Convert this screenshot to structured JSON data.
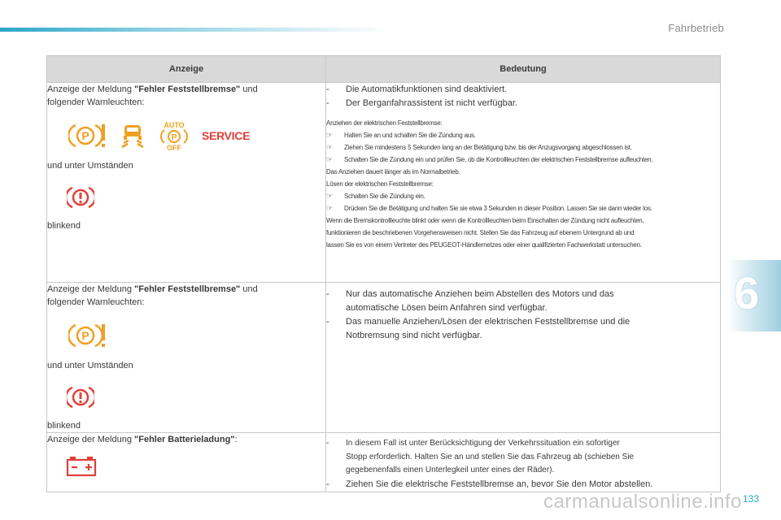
{
  "header": {
    "section_title": "Fahrbetrieb"
  },
  "chapter": {
    "number": "6"
  },
  "footer": {
    "page_number": "133",
    "watermark": "carmanualsonline.info"
  },
  "colors": {
    "accent": "#2aa6c9",
    "warning": "#e0403a",
    "caution": "#f0a020"
  },
  "table": {
    "headers": {
      "left": "Anzeige",
      "right": "Bedeutung"
    },
    "rows": [
      {
        "left": {
          "intro_prefix": "Anzeige der Meldung ",
          "intro_bold": "\"Fehler Feststellbremse\"",
          "intro_suffix": " und",
          "intro_line2": "folgender Warnleuchten:",
          "icons": [
            "parking-brake-warning-icon",
            "hill-start-assist-icon",
            "auto-off-parking-icon",
            "service-icon"
          ],
          "service_label": "SERVICE",
          "auto_label": "AUTO",
          "off_label": "OFF",
          "circumstance": "und unter Umständen",
          "circumstance_icon": "brake-warning-icon",
          "blink": "blinkend"
        },
        "right": {
          "bullets": [
            "Die Automatikfunktionen sind deaktiviert.",
            "Der Berganfahrassistent ist nicht verfügbar."
          ],
          "apply_title": "Anziehen der elektrischen Feststellbremse:",
          "apply_steps": [
            "Halten Sie an und schalten Sie die Zündung aus.",
            "Ziehen Sie mindestens 5 Sekunden lang an der Betätigung bzw. bis der Anzugsvorgang abgeschlossen ist.",
            "Schalten Sie die Zündung ein und prüfen Sie, ob die Kontrollleuchten der elektrischen Feststellbremse aufleuchten."
          ],
          "apply_note": "Das Anziehen dauert länger als im Normalbetrieb.",
          "release_title": "Lösen der elektrischen Feststellbremse:",
          "release_steps": [
            "Schalten Sie die Zündung ein.",
            "Drücken Sie die Betätigung und halten Sie sie etwa 3 Sekunden in dieser Position. Lassen Sie sie dann wieder los."
          ],
          "final_note_1": "Wenn die Bremskontrollleuchte blinkt oder wenn die Kontrollleuchten beim Einschalten der Zündung nicht aufleuchten,",
          "final_note_2": "funktionieren die beschriebenen Vorgehensweisen nicht. Stellen Sie das Fahrzeug auf ebenem Untergrund ab und",
          "final_note_3": "lassen Sie es von einem Vertreter des PEUGEOT-Händlernetzes oder einer qualifizierten Fachwerkstatt untersuchen."
        }
      },
      {
        "left": {
          "intro_prefix": "Anzeige der Meldung ",
          "intro_bold": "\"Fehler Feststellbremse\"",
          "intro_suffix": " und",
          "intro_line2": "folgender Warnleuchten:",
          "icons": [
            "parking-brake-warning-icon"
          ],
          "circumstance": "und unter Umständen",
          "circumstance_icon": "brake-warning-icon",
          "blink": "blinkend"
        },
        "right": {
          "b1_line1": "Nur das automatische Anziehen beim Abstellen des Motors und das",
          "b1_line2": "automatische Lösen beim Anfahren sind verfügbar.",
          "b2_line1": "Das manuelle Anziehen/Lösen der elektrischen Feststellbremse und die",
          "b2_line2": "Notbremsung sind nicht verfügbar."
        }
      },
      {
        "left": {
          "intro_prefix": "Anzeige der Meldung ",
          "intro_bold": "\"Fehler Batterieladung\"",
          "intro_suffix": ":",
          "icons": [
            "battery-charge-icon"
          ]
        },
        "right": {
          "b1_line1": "In diesem Fall ist unter Berücksichtigung der Verkehrssituation ein sofortiger",
          "b1_line2": "Stopp erforderlich. Halten Sie an und stellen Sie das Fahrzeug ab (schieben Sie",
          "b1_line3": "gegebenenfalls einen Unterlegkeil unter eines der Räder).",
          "b2": "Ziehen Sie die elektrische Feststellbremse an, bevor Sie den Motor abstellen."
        }
      }
    ]
  }
}
